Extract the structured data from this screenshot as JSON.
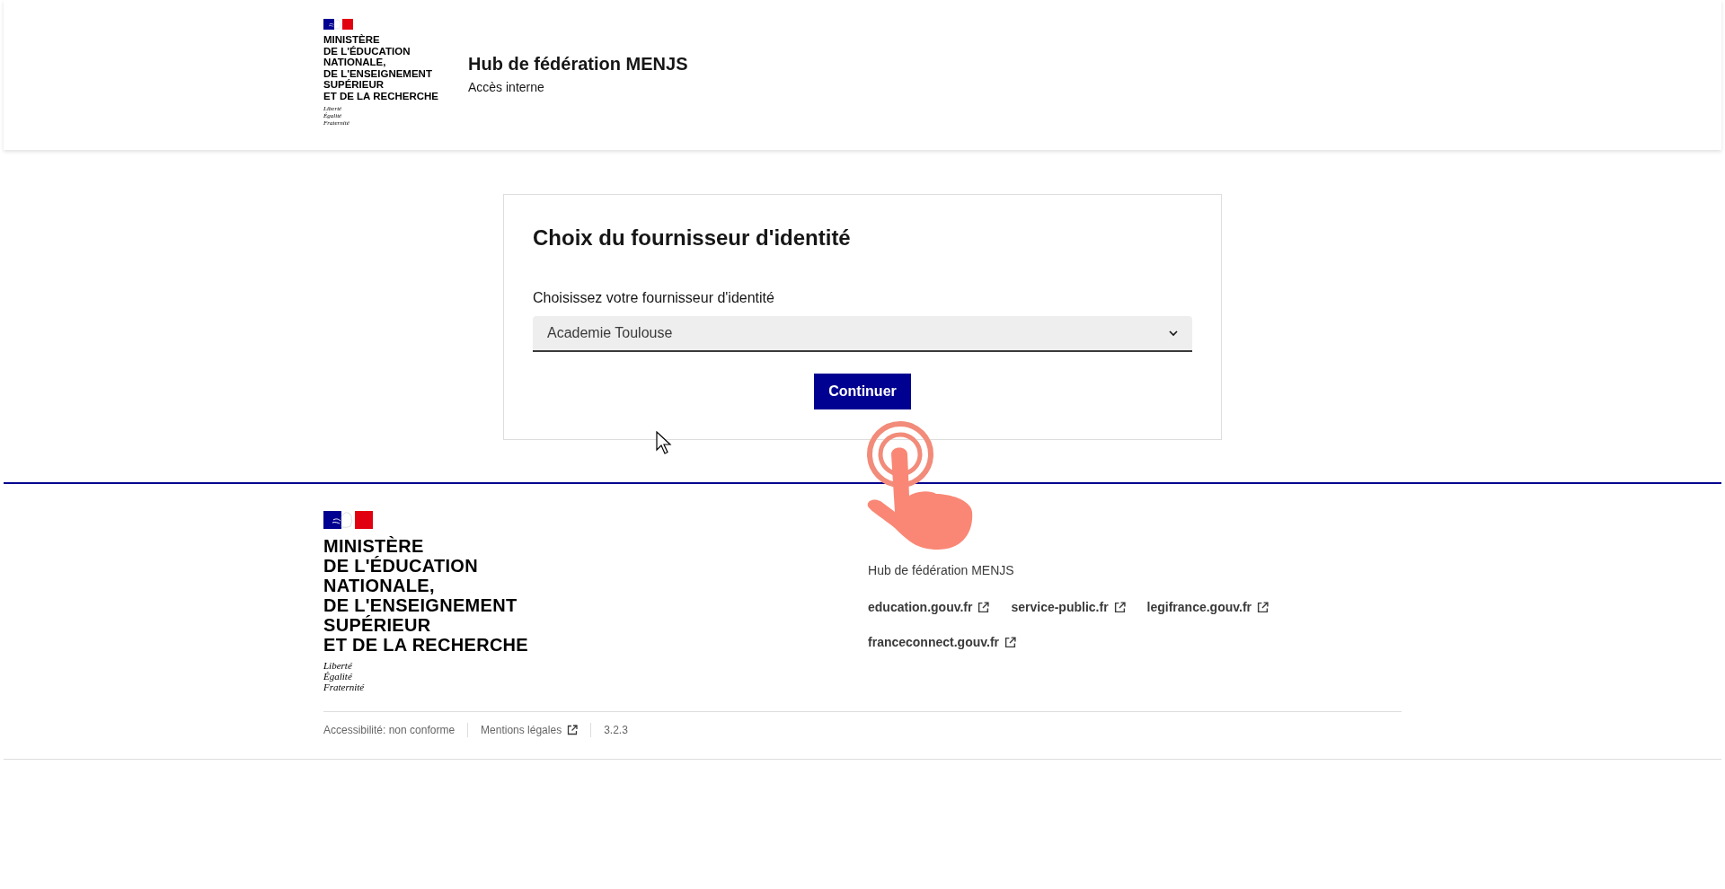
{
  "header": {
    "logo": {
      "ministry_lines": [
        "MINISTÈRE",
        "DE L'ÉDUCATION",
        "NATIONALE,",
        "DE L'ENSEIGNEMENT",
        "SUPÉRIEUR",
        "ET DE LA RECHERCHE"
      ],
      "motto": [
        "Liberté",
        "Égalité",
        "Fraternité"
      ]
    },
    "service_title": "Hub de fédération MENJS",
    "service_tagline": "Accès interne"
  },
  "card": {
    "title": "Choix du fournisseur d'identité",
    "select_label": "Choisissez votre fournisseur d'identité",
    "select_value": "Academie Toulouse",
    "button": "Continuer"
  },
  "footer": {
    "logo": {
      "ministry_lines": [
        "MINISTÈRE",
        "DE L'ÉDUCATION",
        "NATIONALE,",
        "DE L'ENSEIGNEMENT",
        "SUPÉRIEUR",
        "ET DE LA RECHERCHE"
      ],
      "motto": [
        "Liberté",
        "Égalité",
        "Fraternité"
      ]
    },
    "description": "Hub de fédération MENJS",
    "links": [
      {
        "label": "education.gouv.fr"
      },
      {
        "label": "service-public.fr"
      },
      {
        "label": "legifrance.gouv.fr"
      },
      {
        "label": "franceconnect.gouv.fr"
      }
    ],
    "bottom_items": [
      {
        "label": "Accessibilité: non conforme",
        "kind": "text"
      },
      {
        "label": "Mentions légales",
        "kind": "external-link"
      },
      {
        "label": "3.2.3",
        "kind": "text"
      }
    ]
  }
}
